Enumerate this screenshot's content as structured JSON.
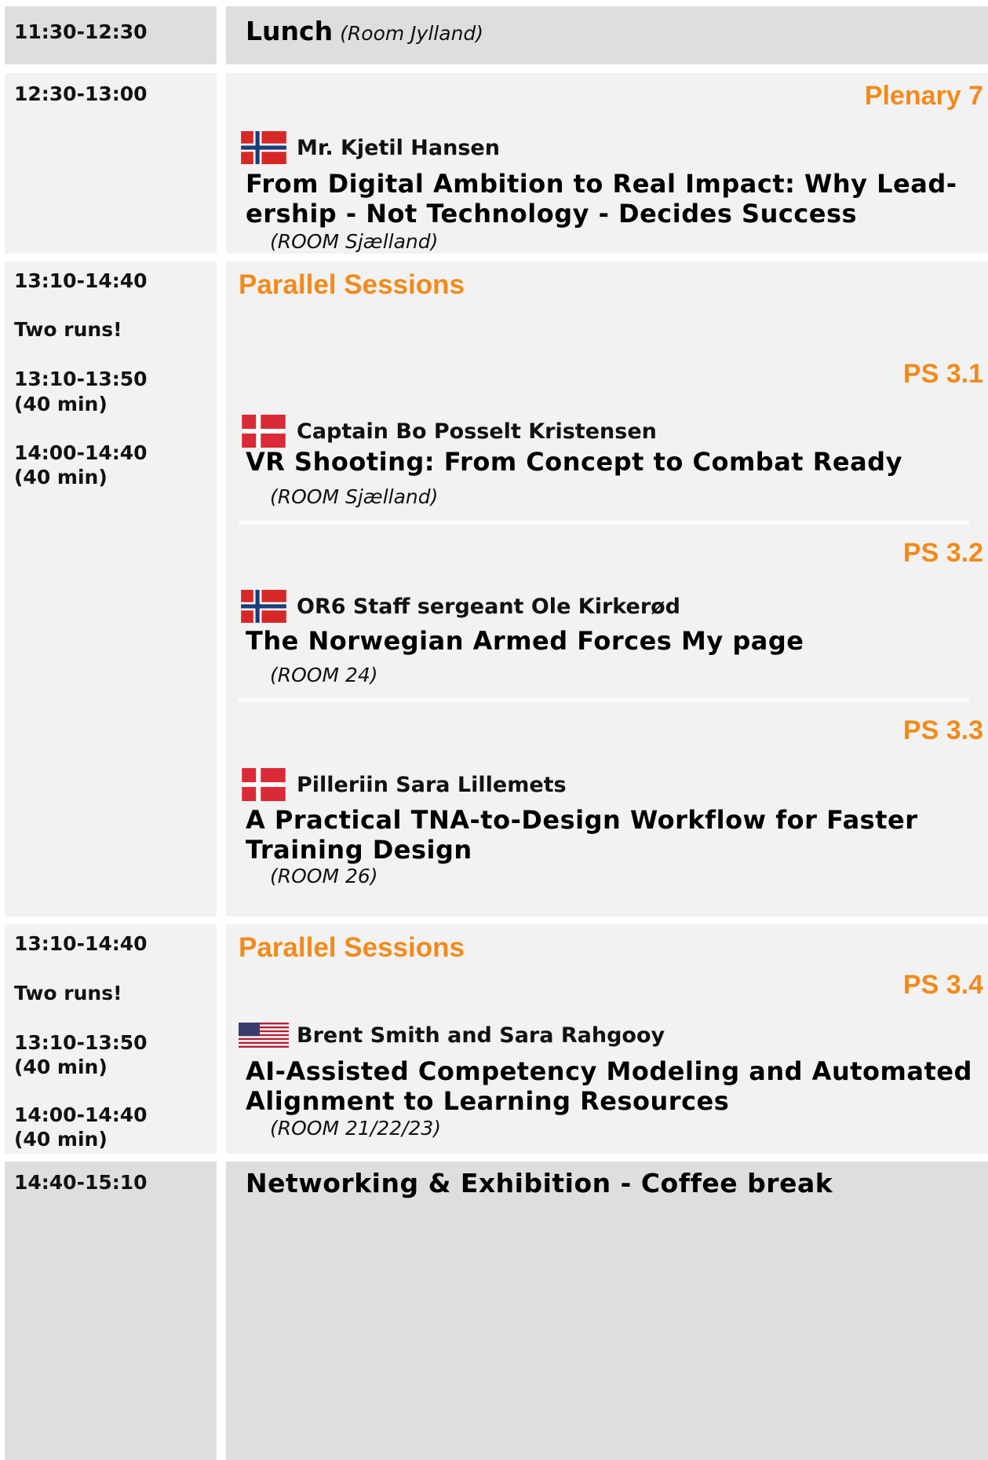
{
  "row_lunch": {
    "time": "11:30-12:30",
    "title": "Lunch",
    "room": "(Room Jylland)"
  },
  "row_plenary": {
    "time": "12:30-13:00",
    "label": "Plenary 7",
    "speaker": "Mr. Kjetil Hansen",
    "speaker_flag": "norway-flag-icon",
    "title": "From Digital Ambition to Real Impact: Why Lead-\nership - Not Technology - Decides Success",
    "room": "(ROOM Sjælland)"
  },
  "row_parallel_1": {
    "time": "13:10-14:40",
    "note": "Two runs!",
    "run1": "13:10-13:50",
    "run1_duration": "(40 min)",
    "run2": "14:00-14:40",
    "run2_duration": "(40 min)",
    "heading": "Parallel Sessions",
    "sessions": [
      {
        "label": "PS 3.1",
        "speaker": "Captain Bo Posselt Kristensen",
        "flag": "denmark-flag-icon",
        "title": "VR Shooting: From Concept to Combat Ready",
        "room": "(ROOM Sjælland)"
      },
      {
        "label": "PS 3.2",
        "speaker": "OR6 Staff sergeant Ole Kirkerød",
        "flag": "norway-flag-icon",
        "title": "The Norwegian Armed Forces My page",
        "room": "(ROOM  24)"
      },
      {
        "label": "PS 3.3",
        "speaker": "Pilleriin Sara Lillemets",
        "flag": "denmark-flag-icon",
        "title": "A Practical TNA-to-Design Workflow for Faster\nTraining Design",
        "room": "(ROOM  26)"
      }
    ]
  },
  "row_parallel_2": {
    "time": "13:10-14:40",
    "note": "Two runs!",
    "run1": "13:10-13:50",
    "run1_duration": "(40 min)",
    "run2": "14:00-14:40",
    "run2_duration": "(40 min)",
    "heading": "Parallel Sessions",
    "session": {
      "label": "PS 3.4",
      "speaker": "Brent Smith and Sara Rahgooy",
      "flag": "usa-flag-icon",
      "title": "AI-Assisted Competency Modeling and Automated\nAlignment to Learning Resources",
      "room": "(ROOM  21/22/23)"
    }
  },
  "row_coffee": {
    "time": "14:40-15:10",
    "title": "Networking & Exhibition - Coffee break"
  },
  "colors": {
    "accent": "#f28a1c",
    "dark_row": "#dedede",
    "light_row": "#f2f2f2"
  }
}
